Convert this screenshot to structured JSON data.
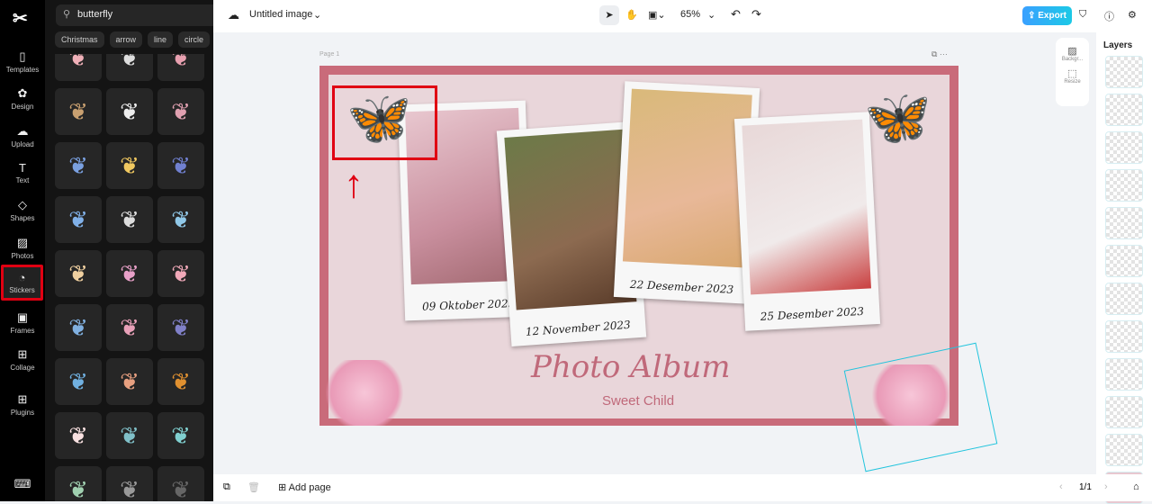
{
  "rail": {
    "items": [
      "Templates",
      "Design",
      "Upload",
      "Text",
      "Shapes",
      "Photos",
      "Stickers",
      "Frames",
      "Collage",
      "Plugins"
    ],
    "active": "Stickers"
  },
  "panel": {
    "search_value": "butterfly",
    "chips": [
      "Christmas",
      "arrow",
      "line",
      "circle"
    ]
  },
  "header": {
    "title": "Untitled image",
    "zoom": "65%",
    "export": "Export"
  },
  "canvas": {
    "page_label": "Page 1",
    "captions": [
      "09 Oktober 2023",
      "12 November 2023",
      "22 Desember 2023",
      "25 Desember 2023"
    ],
    "title": "Photo Album",
    "subtitle": "Sweet Child"
  },
  "side_tools": {
    "background": "Backgr...",
    "resize": "Resize"
  },
  "layers": {
    "title": "Layers"
  },
  "footer": {
    "add_page": "Add page",
    "page_count": "1/1"
  },
  "colors": {
    "accent": "#1cc9e6",
    "frame": "#c96b7a",
    "highlight": "#e00012"
  }
}
